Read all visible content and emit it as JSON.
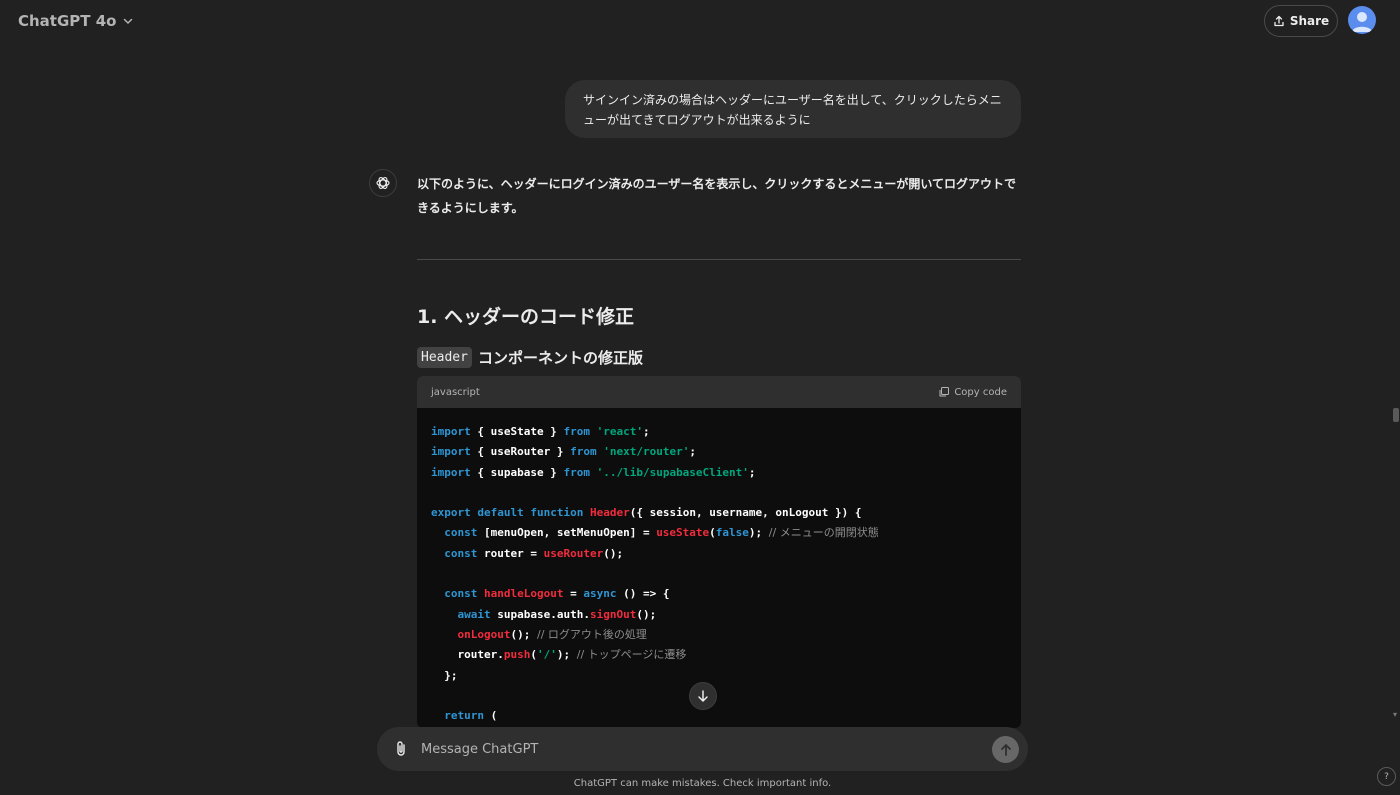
{
  "header": {
    "model_name": "ChatGPT 4o",
    "share_label": "Share"
  },
  "conversation": {
    "user_message": "サインイン済みの場合はヘッダーにユーザー名を出して、クリックしたらメニューが出てきてログアウトが出来るように",
    "assistant_intro": "以下のように、ヘッダーにログイン済みのユーザー名を表示し、クリックするとメニューが開いてログアウトできるようにします。",
    "section_title": "1. ヘッダーのコード修正",
    "subsection_code": "Header",
    "subsection_text": "コンポーネントの修正版",
    "code_block": {
      "language": "javascript",
      "copy_label": "Copy code",
      "comment_menu_state": "// メニューの開閉状態",
      "comment_after_logout": "// ログアウト後の処理",
      "comment_to_top": "// トップページに遷移"
    }
  },
  "composer": {
    "placeholder": "Message ChatGPT"
  },
  "footer": {
    "disclaimer": "ChatGPT can make mistakes. Check important info.",
    "help": "?"
  },
  "colors": {
    "background": "#212121",
    "bubble": "#2f2f2f",
    "code_bg": "#0d0d0d",
    "keyword": "#2e95d3",
    "string": "#00a67d",
    "function": "#f22c3d",
    "comment": "#8d8d8d"
  }
}
